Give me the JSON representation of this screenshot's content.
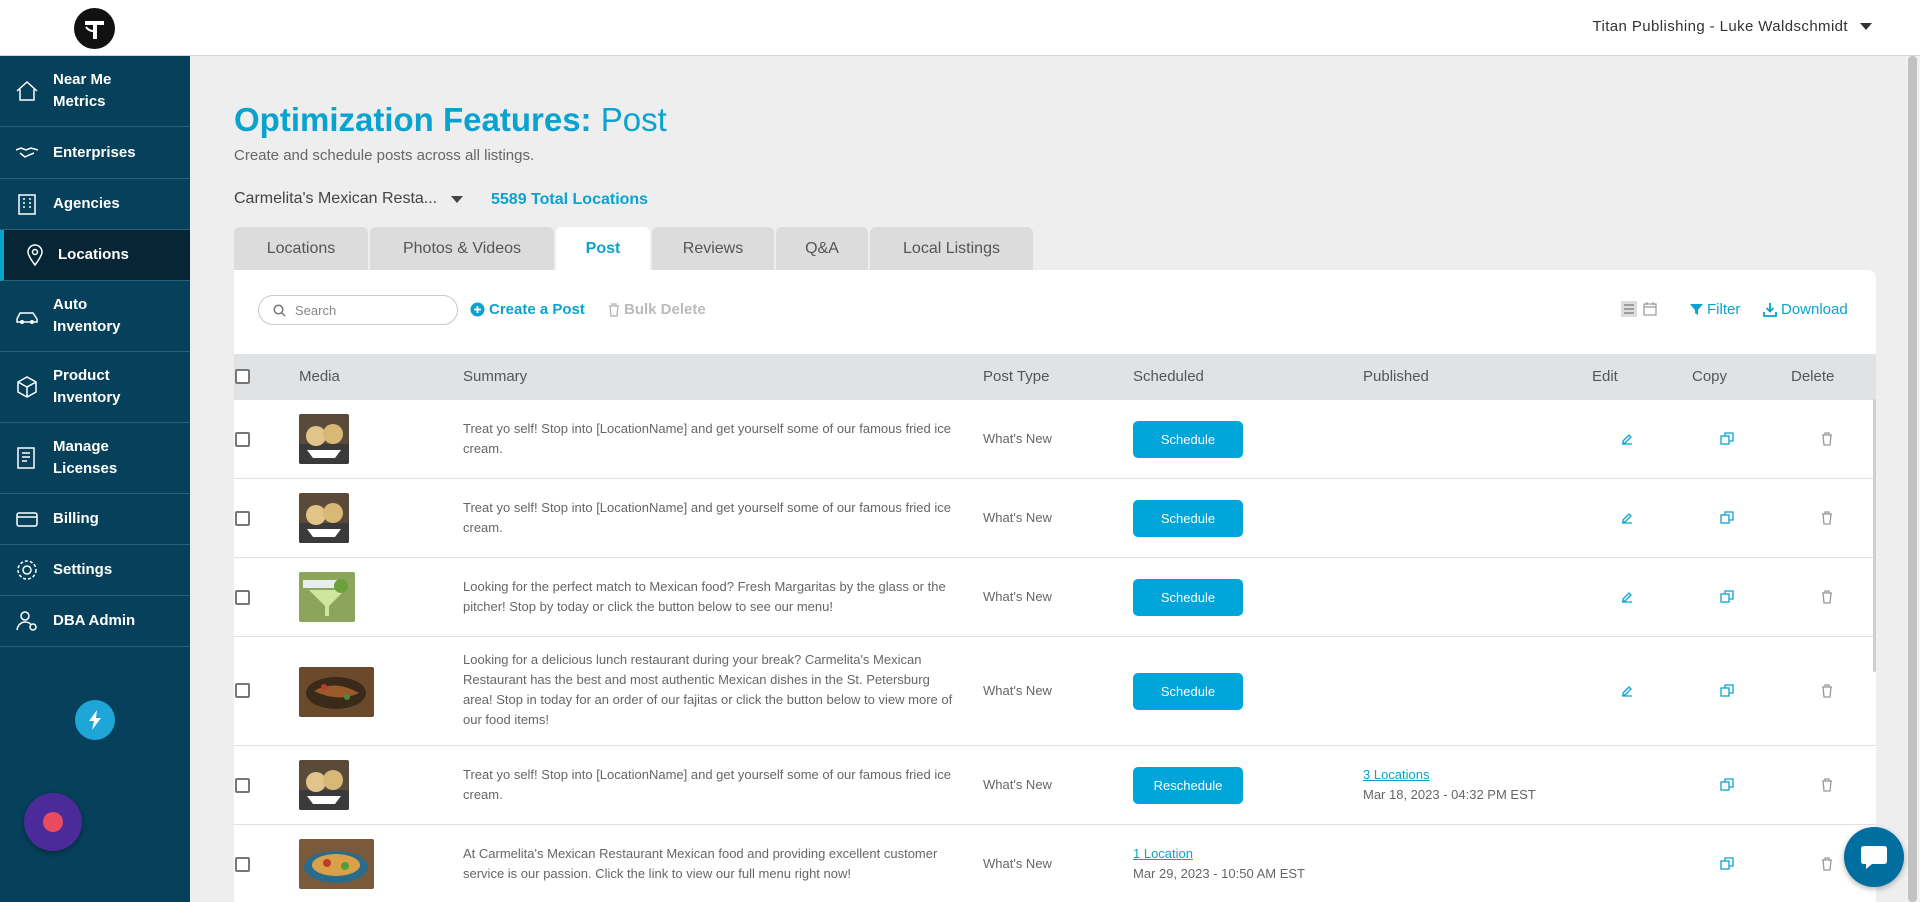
{
  "header": {
    "account_label": "Titan Publishing - Luke Waldschmidt"
  },
  "sidebar": {
    "items": [
      {
        "label": "Near Me Metrics",
        "icon": "home-icon"
      },
      {
        "label": "Enterprises",
        "icon": "handshake-icon"
      },
      {
        "label": "Agencies",
        "icon": "building-icon"
      },
      {
        "label": "Locations",
        "icon": "map-pin-icon",
        "active": true
      },
      {
        "label": "Auto Inventory",
        "icon": "car-icon"
      },
      {
        "label": "Product Inventory",
        "icon": "box-icon"
      },
      {
        "label": "Manage Licenses",
        "icon": "license-icon"
      },
      {
        "label": "Billing",
        "icon": "billing-icon"
      },
      {
        "label": "Settings",
        "icon": "gear-icon"
      },
      {
        "label": "DBA Admin",
        "icon": "admin-user-icon"
      }
    ]
  },
  "page": {
    "title_bold": "Optimization Features:",
    "title_light": "Post",
    "subtitle": "Create and schedule posts across all listings.",
    "location_selector": "Carmelita's Mexican Resta...",
    "total_locations": "5589 Total Locations"
  },
  "tabs": [
    {
      "label": "Locations"
    },
    {
      "label": "Photos & Videos"
    },
    {
      "label": "Post",
      "active": true
    },
    {
      "label": "Reviews"
    },
    {
      "label": "Q&A"
    },
    {
      "label": "Local Listings"
    }
  ],
  "toolbar": {
    "search_placeholder": "Search",
    "create_label": "Create a Post",
    "bulk_delete_label": "Bulk Delete",
    "filter_label": "Filter",
    "download_label": "Download"
  },
  "table": {
    "columns": {
      "media": "Media",
      "summary": "Summary",
      "post_type": "Post Type",
      "scheduled": "Scheduled",
      "published": "Published",
      "edit": "Edit",
      "copy": "Copy",
      "delete": "Delete"
    },
    "rows": [
      {
        "summary": "Treat yo self! Stop into [LocationName] and get yourself some of our famous fried ice cream.",
        "post_type": "What's New",
        "scheduled_button": "Schedule"
      },
      {
        "summary": "Treat yo self! Stop into [LocationName] and get yourself some of our famous fried ice cream.",
        "post_type": "What's New",
        "scheduled_button": "Schedule"
      },
      {
        "summary": "Looking for the perfect match to Mexican food? Fresh Margaritas by the glass or the pitcher! Stop by today or click the button below to see our menu!",
        "post_type": "What's New",
        "scheduled_button": "Schedule"
      },
      {
        "summary": "Looking for a delicious lunch restaurant during your break? Carmelita's Mexican Restaurant has the best and most authentic Mexican dishes in the St. Petersburg area! Stop in today for an order of our fajitas or click the button below to view more of our food items!",
        "post_type": "What's New",
        "scheduled_button": "Schedule"
      },
      {
        "summary": "Treat yo self! Stop into [LocationName] and get yourself some of our famous fried ice cream.",
        "post_type": "What's New",
        "scheduled_button": "Reschedule",
        "published_link": "3 Locations",
        "published_date": "Mar 18, 2023 - 04:32 PM EST"
      },
      {
        "summary": "At Carmelita's Mexican Restaurant Mexican food and providing excellent customer service is our passion. Click the link to view our full menu right now!",
        "post_type": "What's New",
        "scheduled_link": "1 Location",
        "scheduled_date": "Mar 29, 2023 - 10:50 AM EST"
      }
    ]
  },
  "colors": {
    "accent": "#0aa3cf",
    "sidebar": "#07405a",
    "button": "#00a5da"
  }
}
